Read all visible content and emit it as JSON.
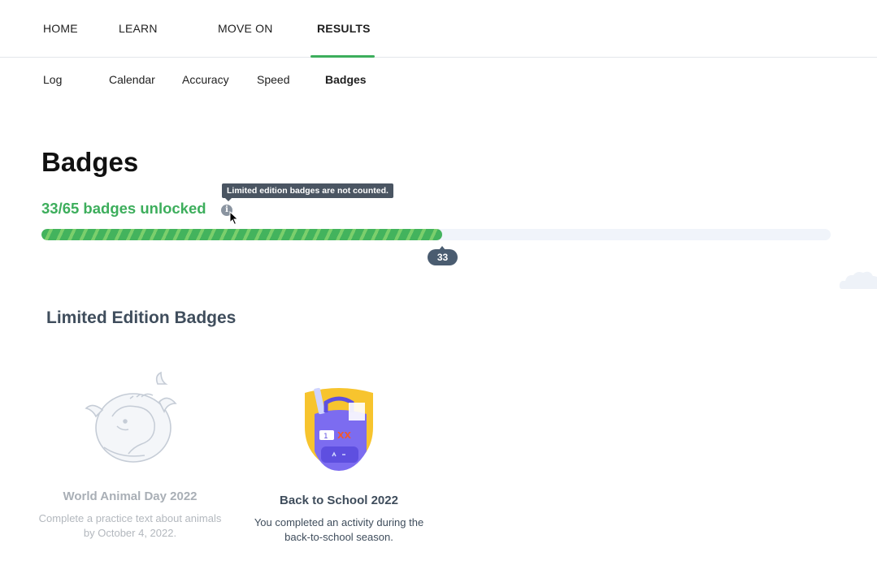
{
  "top_nav": {
    "items": [
      {
        "label": "HOME",
        "active": false
      },
      {
        "label": "LEARN",
        "active": false
      },
      {
        "label": "MOVE ON",
        "active": false
      },
      {
        "label": "RESULTS",
        "active": true
      }
    ],
    "accent_color": "#3dae5c"
  },
  "sub_nav": {
    "items": [
      {
        "label": "Log",
        "active": false
      },
      {
        "label": "Calendar",
        "active": false
      },
      {
        "label": "Accuracy",
        "active": false
      },
      {
        "label": "Speed",
        "active": false
      },
      {
        "label": "Badges",
        "active": true
      }
    ]
  },
  "page": {
    "title": "Badges",
    "tooltip": "Limited edition badges are not counted.",
    "unlocked_text": "33/65 badges unlocked",
    "info_icon": "info-icon",
    "progress": {
      "current": 33,
      "total": 65,
      "label": "33"
    }
  },
  "limited_section": {
    "title": "Limited Edition Badges",
    "badges": [
      {
        "name": "World Animal Day 2022",
        "description": "Complete a practice text about animals by October 4, 2022.",
        "status": "locked",
        "icon": "whale-elephant-badge-icon"
      },
      {
        "name": "Back to School 2022",
        "description": "You completed an activity during the back-to-school season.",
        "status": "unlocked",
        "icon": "backpack-badge-icon"
      }
    ]
  },
  "colors": {
    "green": "#3dae5c",
    "slate": "#3f4d5c",
    "locked_gray": "#a9afb6"
  }
}
